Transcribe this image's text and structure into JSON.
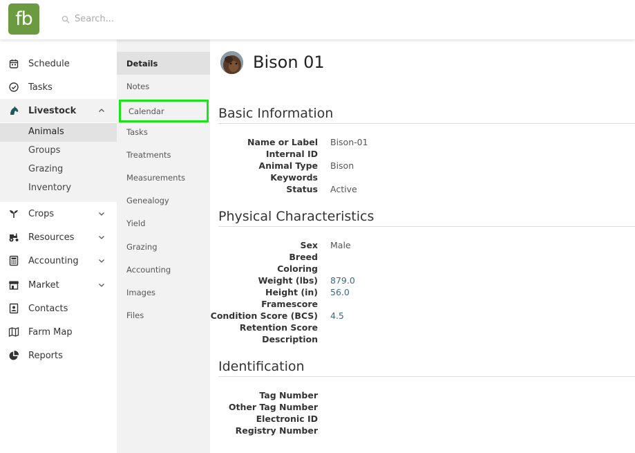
{
  "header": {
    "logo_text": "fb",
    "search_placeholder": "Search...",
    "brand_color": "#6c9a40"
  },
  "sidebar": {
    "items": [
      {
        "label": "Schedule",
        "icon": "calendar-icon"
      },
      {
        "label": "Tasks",
        "icon": "check-circle-icon"
      },
      {
        "label": "Livestock",
        "icon": "horse-icon"
      },
      {
        "label": "Crops",
        "icon": "sprout-icon"
      },
      {
        "label": "Resources",
        "icon": "tractor-icon"
      },
      {
        "label": "Accounting",
        "icon": "calculator-icon"
      },
      {
        "label": "Market",
        "icon": "store-icon"
      },
      {
        "label": "Contacts",
        "icon": "contact-card-icon"
      },
      {
        "label": "Farm Map",
        "icon": "map-icon"
      },
      {
        "label": "Reports",
        "icon": "pie-chart-icon"
      }
    ],
    "livestock_sub": [
      "Animals",
      "Groups",
      "Grazing",
      "Inventory"
    ]
  },
  "subnav": {
    "tabs": [
      "Details",
      "Notes",
      "Calendar",
      "Tasks",
      "Treatments",
      "Measurements",
      "Genealogy",
      "Yield",
      "Grazing",
      "Accounting",
      "Images",
      "Files"
    ]
  },
  "main": {
    "title": "Bison 01",
    "sections": {
      "basic": {
        "title": "Basic Information",
        "rows": [
          {
            "k": "Name or Label",
            "v": "Bison-01"
          },
          {
            "k": "Internal ID",
            "v": ""
          },
          {
            "k": "Animal Type",
            "v": "Bison"
          },
          {
            "k": "Keywords",
            "v": ""
          },
          {
            "k": "Status",
            "v": "Active"
          }
        ]
      },
      "physical": {
        "title": "Physical Characteristics",
        "rows": [
          {
            "k": "Sex",
            "v": "Male"
          },
          {
            "k": "Breed",
            "v": ""
          },
          {
            "k": "Coloring",
            "v": ""
          },
          {
            "k": "Weight (lbs)",
            "v": "879.0"
          },
          {
            "k": "Height (in)",
            "v": "56.0"
          },
          {
            "k": "Framescore",
            "v": ""
          },
          {
            "k": "Condition Score (BCS)",
            "v": "4.5"
          },
          {
            "k": "Retention Score",
            "v": ""
          },
          {
            "k": "Description",
            "v": ""
          }
        ]
      },
      "identification": {
        "title": "Identification",
        "rows": [
          {
            "k": "Tag Number",
            "v": ""
          },
          {
            "k": "Other Tag Number",
            "v": ""
          },
          {
            "k": "Electronic ID",
            "v": ""
          },
          {
            "k": "Registry Number",
            "v": ""
          }
        ]
      }
    }
  }
}
